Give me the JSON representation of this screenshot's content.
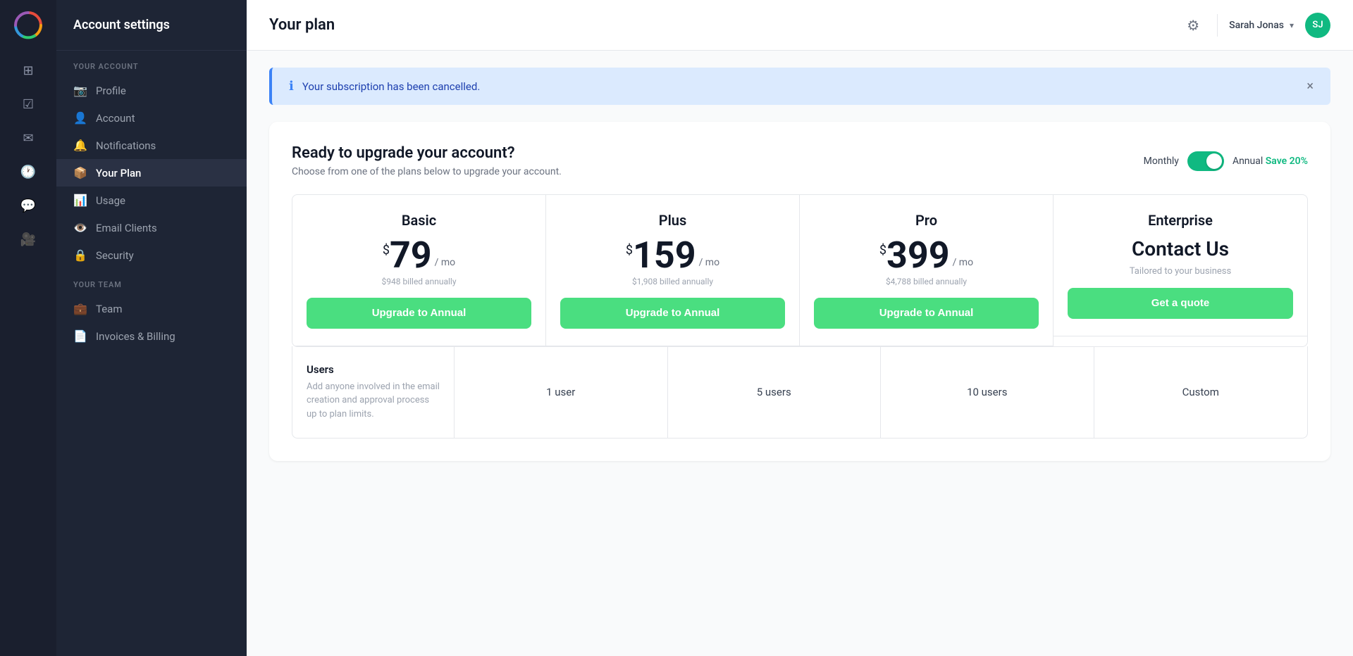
{
  "app": {
    "logo_initials": "●",
    "title": "Account settings"
  },
  "sidebar": {
    "your_account_label": "YOUR ACCOUNT",
    "your_team_label": "YOUR TEAM",
    "items": [
      {
        "id": "profile",
        "label": "Profile",
        "icon": "📷"
      },
      {
        "id": "account",
        "label": "Account",
        "icon": "👤"
      },
      {
        "id": "notifications",
        "label": "Notifications",
        "icon": "🔔"
      },
      {
        "id": "your-plan",
        "label": "Your Plan",
        "icon": "📦",
        "active": true
      },
      {
        "id": "usage",
        "label": "Usage",
        "icon": "📊"
      },
      {
        "id": "email-clients",
        "label": "Email Clients",
        "icon": "👁️"
      },
      {
        "id": "security",
        "label": "Security",
        "icon": "🔒"
      },
      {
        "id": "team",
        "label": "Team",
        "icon": "💼"
      },
      {
        "id": "invoices",
        "label": "Invoices & Billing",
        "icon": "📄"
      }
    ]
  },
  "header": {
    "page_title": "Your plan",
    "settings_icon": "⚙",
    "user_name": "Sarah Jonas",
    "user_initials": "SJ"
  },
  "alert": {
    "message": "Your subscription has been cancelled.",
    "close_label": "×"
  },
  "plan": {
    "title": "Ready to upgrade your account?",
    "subtitle": "Choose from one of the plans below to upgrade your account.",
    "billing_monthly_label": "Monthly",
    "billing_annual_label": "Annual",
    "save_badge": "Save 20%",
    "plans": [
      {
        "id": "basic",
        "name": "Basic",
        "price": "79",
        "period": "/ mo",
        "annual": "$948 billed annually",
        "cta": "Upgrade to Annual",
        "users": "1 user"
      },
      {
        "id": "plus",
        "name": "Plus",
        "price": "159",
        "period": "/ mo",
        "annual": "$1,908 billed annually",
        "cta": "Upgrade to Annual",
        "users": "5 users"
      },
      {
        "id": "pro",
        "name": "Pro",
        "price": "399",
        "period": "/ mo",
        "annual": "$4,788 billed annually",
        "cta": "Upgrade to Annual",
        "users": "10 users"
      },
      {
        "id": "enterprise",
        "name": "Enterprise",
        "price_label": "Contact Us",
        "enterprise_sub": "Tailored to your business",
        "cta": "Get a quote",
        "users": "Custom"
      }
    ],
    "features": [
      {
        "label": "Users",
        "description": "Add anyone involved in the email creation and approval process up to plan limits.",
        "values": [
          "1 user",
          "5 users",
          "10 users",
          "Custom"
        ]
      }
    ]
  }
}
